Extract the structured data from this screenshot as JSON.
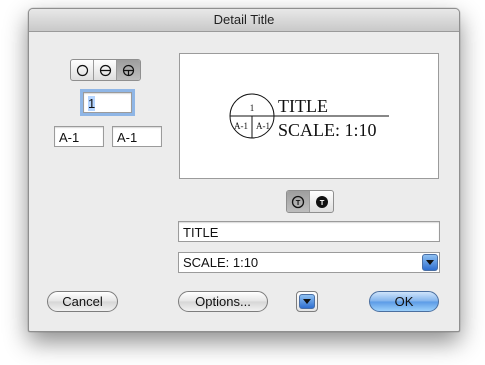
{
  "window": {
    "title": "Detail Title"
  },
  "symbol_style": {
    "selected_index": 2,
    "options": [
      "circle-icon",
      "circle-with-bar-icon",
      "circle-with-cross-icon"
    ]
  },
  "detail": {
    "number": "1",
    "sheet_left": "A-1",
    "sheet_right": "A-1"
  },
  "preview": {
    "number": "1",
    "sheet_left": "A-1",
    "sheet_right": "A-1",
    "title": "TITLE",
    "scale": "SCALE: 1:10"
  },
  "title_position": {
    "selected_index": 0,
    "options": [
      "title-outline-icon",
      "title-filled-icon"
    ]
  },
  "title_field": {
    "value": "TITLE"
  },
  "scale_select": {
    "value": "SCALE: 1:10"
  },
  "buttons": {
    "cancel": "Cancel",
    "options": "Options...",
    "ok": "OK"
  },
  "colors": {
    "accent": "#5a9ae6",
    "focus_ring": "#8fb6e6",
    "selection": "#b5d5ff"
  }
}
